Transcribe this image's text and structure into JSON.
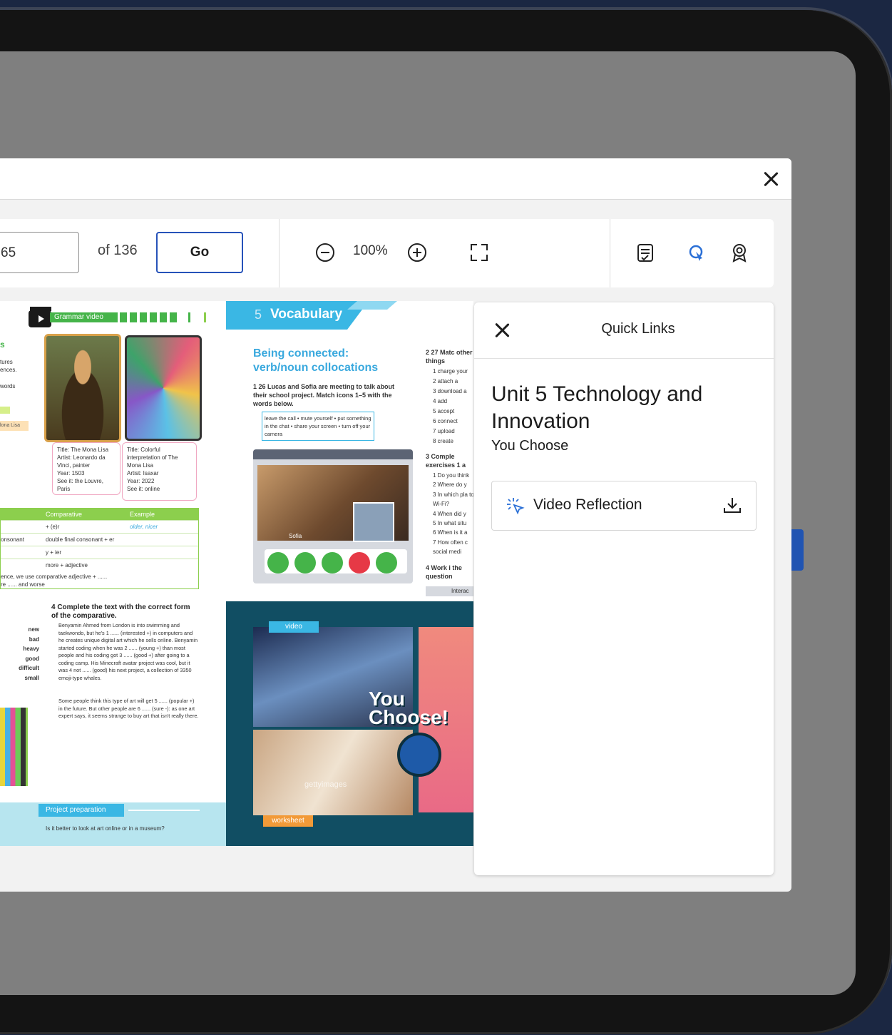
{
  "toolbar": {
    "page_value": "65",
    "of_label": "of 136",
    "go_label": "Go",
    "zoom_value": "100%",
    "icons": [
      "zoom-out-icon",
      "zoom-in-icon",
      "fullscreen-icon",
      "notes-icon",
      "highlighter-icon",
      "award-icon"
    ]
  },
  "colors": {
    "primary": "#2652b9",
    "vocab_blue": "#3ab7e4",
    "grammar_green": "#45b449",
    "video_panel": "#114e63"
  },
  "book": {
    "left": {
      "grammar_video_label": "Grammar video",
      "caption1": {
        "title": "Title: The Mona Lisa",
        "artist": "Artist: Leonardo da Vinci, painter",
        "year": "Year: 1503",
        "see": "See it: the Louvre, Paris"
      },
      "caption2": {
        "title": "Title: Colorful interpretation of The Mona Lisa",
        "artist": "Artist: Isaxar",
        "year": "Year: 2022",
        "see": "See it: online"
      },
      "table_headers": [
        "Comparative",
        "Example"
      ],
      "table_rows": [
        [
          "",
          "+ (e)r",
          "older, nicer"
        ],
        [
          "onsonant",
          "double final consonant + er",
          ""
        ],
        [
          "",
          "y + ier",
          ""
        ],
        [
          "",
          "more + adjective",
          ""
        ]
      ],
      "table_note": "ence, we use comparative adjective + ......",
      "table_note2": "re ...... and worse",
      "ex4_title": "4 Complete the text with the correct form of the comparative.",
      "ex4_words": [
        "new",
        "bad",
        "heavy",
        "good",
        "difficult",
        "small"
      ],
      "ex4_text": "Benyamin Ahmed from London is into swimming and taekwondo, but he's 1 ...... (interested +) in computers and he creates unique digital art which he sells online. Benyamin started coding when he was 2 ...... (young +) than most people and his coding got 3 ...... (good +) after going to a coding camp. His Minecraft avatar project was cool, but it was 4 not ...... (good) his next project, a collection of 3350 emoji-type whales.",
      "ex4_text2": "Some people think this type of art will get 5 ...... (popular +) in the future. But other people are 6 ...... (sure -): as one art expert says, it seems strange to buy art that isn't really there.",
      "project_label": "Project preparation",
      "project_question": "Is it better to look at art online or in a museum?"
    },
    "right": {
      "unit_number": "5",
      "unit_section": "Vocabulary",
      "subtitle": "Being connected: verb/noun collocations",
      "ex1": "1 26 Lucas and Sofia are meeting to talk about their school project. Match icons 1–5 with the words below.",
      "word_box": "leave the call • mute yourself • put something in the chat • share your screen • turn off your camera",
      "sofia_label": "Sofia",
      "ex2_title": "2 27 Matc other things",
      "ex2_items": [
        "1 charge your",
        "2 attach a",
        "3 download a",
        "4 add",
        "5 accept",
        "6 connect",
        "7 upload",
        "8 create"
      ],
      "ex3_title": "3 Comple exercises 1 a",
      "ex3_items": [
        "1 Do you think",
        "2 Where do y",
        "3 In which pla to Wi-Fi?",
        "4 When did y",
        "5 In what situ",
        "6 When is it a",
        "7 How often c social medi"
      ],
      "ex4_title": "4 Work i the question",
      "interactive_label": "Interac",
      "video_label": "video",
      "you_choose": "You Choose!",
      "worksheet_label": "worksheet",
      "watermark": "gettyimages"
    }
  },
  "quick_links": {
    "title": "Quick Links",
    "unit_title": "Unit 5 Technology and Innovation",
    "subtitle": "You Choose",
    "items": [
      {
        "label": "Video Reflection",
        "icon": "sparkle-pointer-icon",
        "action_icon": "download-icon"
      }
    ]
  }
}
